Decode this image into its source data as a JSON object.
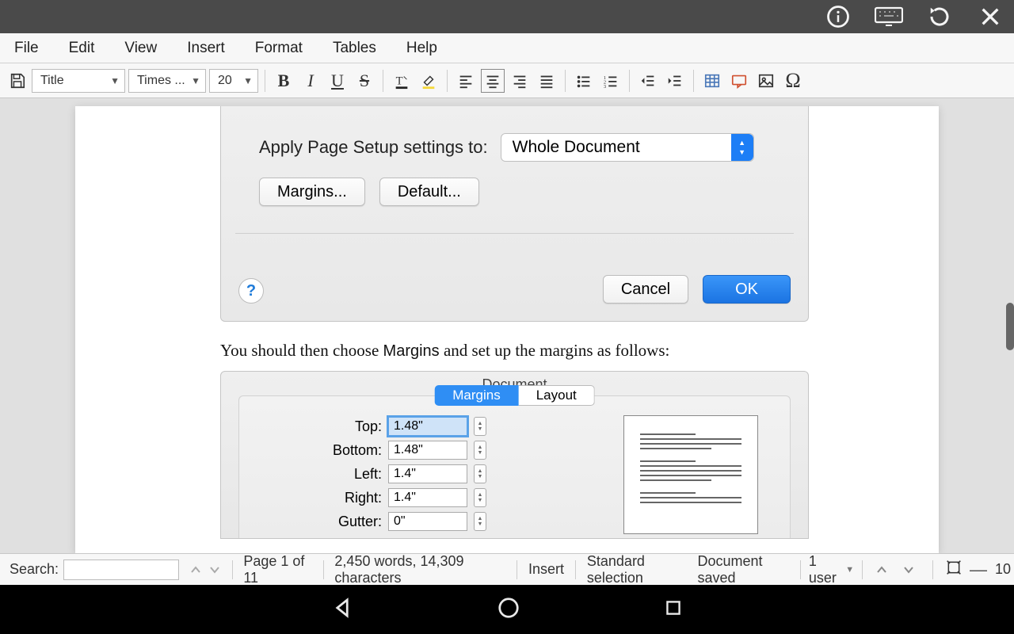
{
  "menubar": [
    "File",
    "Edit",
    "View",
    "Insert",
    "Format",
    "Tables",
    "Help"
  ],
  "toolbar": {
    "style": "Title",
    "font": "Times ...",
    "size": "20"
  },
  "dlg1": {
    "apply_label": "Apply Page Setup settings to:",
    "apply_value": "Whole Document",
    "margins_btn": "Margins...",
    "default_btn": "Default...",
    "help": "?",
    "cancel": "Cancel",
    "ok": "OK"
  },
  "caption_pre": "You should then choose ",
  "caption_bold": "Margins",
  "caption_post": " and set up the margins as follows:",
  "dlg2": {
    "title": "Document",
    "tab_active": "Margins",
    "tab_inactive": "Layout",
    "fields": {
      "top_l": "Top:",
      "top_v": "1.48\"",
      "bottom_l": "Bottom:",
      "bottom_v": "1.48\"",
      "left_l": "Left:",
      "left_v": "1.4\"",
      "right_l": "Right:",
      "right_v": "1.4\"",
      "gutter_l": "Gutter:",
      "gutter_v": "0\""
    }
  },
  "status": {
    "search_label": "Search:",
    "page": "Page 1 of 11",
    "words": "2,450 words, 14,309 characters",
    "insert": "Insert",
    "selection": "Standard selection",
    "saved": "Document saved",
    "users": "1 user",
    "zoom": "10"
  }
}
